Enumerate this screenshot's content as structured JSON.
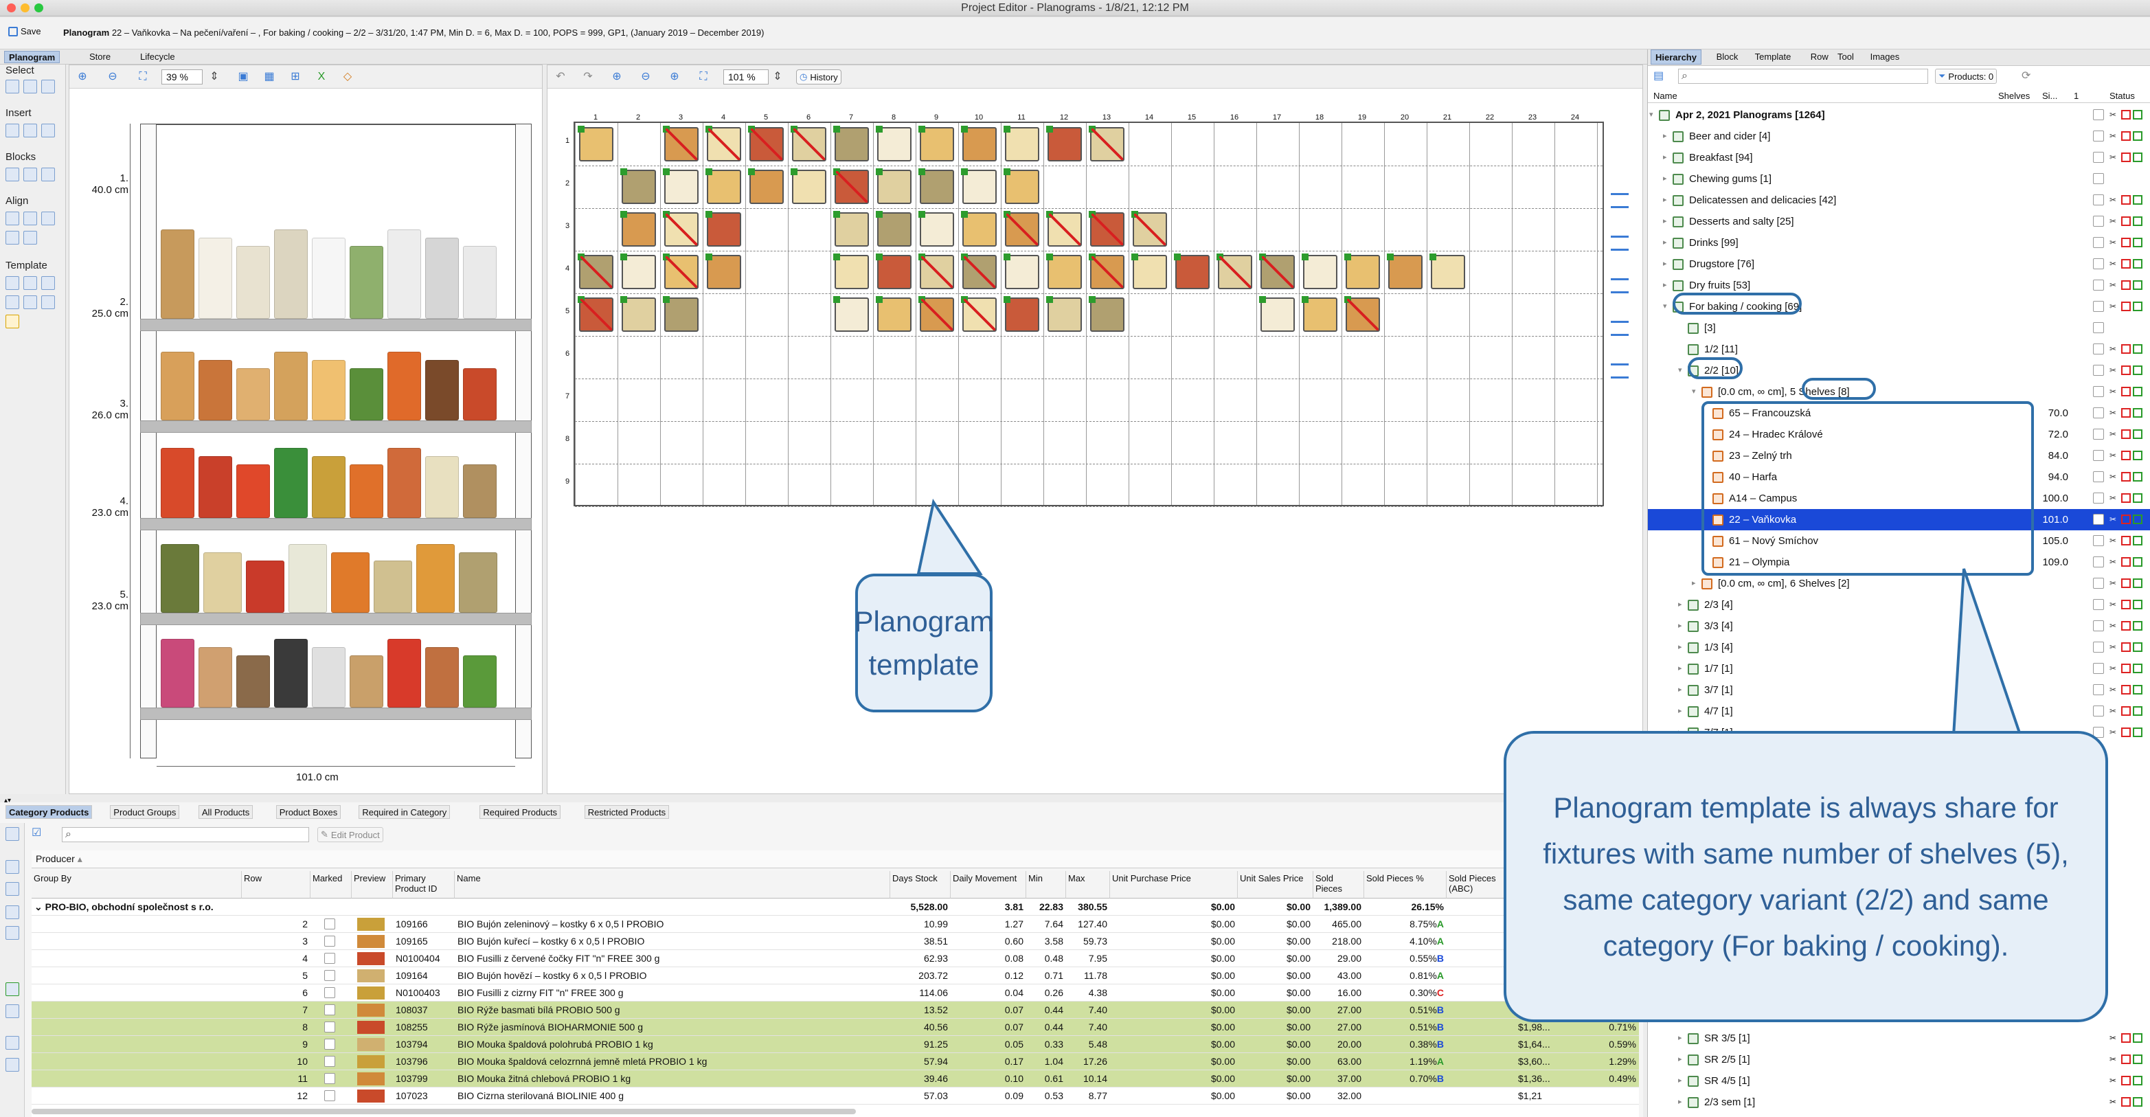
{
  "window": {
    "title": "Project Editor - Planograms - 1/8/21, 12:12 PM"
  },
  "infobar": {
    "save_label": "Save",
    "planogram_prefix": "Planogram",
    "planogram_desc": "22 – Vaňkovka – Na pečení/vaření – , For baking / cooking – 2/2 – 3/31/20, 1:47 PM, Min D. = 6, Max D. = 100, POPS = 999, GP1, (January 2019 – December 2019)"
  },
  "top_tabs": [
    "Planogram",
    "Store",
    "Lifecycle"
  ],
  "palette": {
    "select": "Select",
    "insert": "Insert",
    "blocks": "Blocks",
    "align": "Align",
    "template": "Template"
  },
  "panel1": {
    "zoom": "39 %",
    "width_label": "101.0 cm",
    "shelves": [
      {
        "num": "1.",
        "height": "40.0 cm"
      },
      {
        "num": "2.",
        "height": "25.0 cm"
      },
      {
        "num": "3.",
        "height": "26.0 cm"
      },
      {
        "num": "4.",
        "height": "23.0 cm"
      },
      {
        "num": "5.",
        "height": "23.0 cm"
      }
    ]
  },
  "panel2": {
    "zoom": "101 %",
    "history_label": "History",
    "columns": [
      "1",
      "2",
      "3",
      "4",
      "5",
      "6",
      "7",
      "8",
      "9",
      "10",
      "11",
      "12",
      "13",
      "14",
      "15",
      "16",
      "17",
      "18",
      "19",
      "20",
      "21",
      "22",
      "23",
      "24"
    ],
    "rows": [
      "1",
      "2",
      "3",
      "4",
      "5",
      "6",
      "7",
      "8",
      "9"
    ],
    "callout": "Planogram template"
  },
  "bottom": {
    "tabs": [
      "Category Products",
      "Product Groups",
      "All Products",
      "Product Boxes",
      "Required in Category",
      "Required Products",
      "Restricted Products"
    ],
    "edit_product_label": "Edit Product",
    "group_header": "Producer",
    "columns": [
      "Group By",
      "Row",
      "Marked",
      "Preview",
      "Primary Product ID",
      "Name",
      "Days Stock",
      "Daily Movement",
      "Min",
      "Max",
      "Unit Purchase Price",
      "Unit Sales Price",
      "Sold Pieces",
      "Sold Pieces %",
      "Sold Pieces (ABC)",
      "T"
    ],
    "group_row": {
      "name": "PRO-BIO, obchodní společnost s r.o.",
      "days": "5,528.00",
      "daily": "3.81",
      "min": "22.83",
      "max": "380.55",
      "upp": "$0.00",
      "usp": "$0.00",
      "sold": "1,389.00",
      "pct": "26.15%",
      "t": "$"
    },
    "rows": [
      {
        "row": "2",
        "id": "109166",
        "name": "BIO Bujón zeleninový – kostky 6 x 0,5 l PROBIO",
        "days": "10.99",
        "daily": "1.27",
        "min": "7.64",
        "max": "127.40",
        "upp": "$0.00",
        "usp": "$0.00",
        "sold": "465.00",
        "pct": "8.75%",
        "abc": "A",
        "hl": false,
        "t": "",
        "t2": ""
      },
      {
        "row": "3",
        "id": "109165",
        "name": "BIO Bujón kuřecí – kostky 6 x 0,5 l PROBIO",
        "days": "38.51",
        "daily": "0.60",
        "min": "3.58",
        "max": "59.73",
        "upp": "$0.00",
        "usp": "$0.00",
        "sold": "218.00",
        "pct": "4.10%",
        "abc": "A",
        "hl": false,
        "t": "",
        "t2": ""
      },
      {
        "row": "4",
        "id": "N0100404",
        "name": "BIO Fusilli z červené čočky FIT \"n\" FREE 300 g",
        "days": "62.93",
        "daily": "0.08",
        "min": "0.48",
        "max": "7.95",
        "upp": "$0.00",
        "usp": "$0.00",
        "sold": "29.00",
        "pct": "0.55%",
        "abc": "B",
        "hl": false,
        "t": "",
        "t2": ""
      },
      {
        "row": "5",
        "id": "109164",
        "name": "BIO Bujón hovězí – kostky 6 x 0,5 l PROBIO",
        "days": "203.72",
        "daily": "0.12",
        "min": "0.71",
        "max": "11.78",
        "upp": "$0.00",
        "usp": "$0.00",
        "sold": "43.00",
        "pct": "0.81%",
        "abc": "A",
        "hl": false,
        "t": "",
        "t2": ""
      },
      {
        "row": "6",
        "id": "N0100403",
        "name": "BIO Fusilli z cizrny FIT \"n\" FREE 300 g",
        "days": "114.06",
        "daily": "0.04",
        "min": "0.26",
        "max": "4.38",
        "upp": "$0.00",
        "usp": "$0.00",
        "sold": "16.00",
        "pct": "0.30%",
        "abc": "C",
        "hl": false,
        "t": "",
        "t2": ""
      },
      {
        "row": "7",
        "id": "108037",
        "name": "BIO Rýže basmati bílá PROBIO 500 g",
        "days": "13.52",
        "daily": "0.07",
        "min": "0.44",
        "max": "7.40",
        "upp": "$0.00",
        "usp": "$0.00",
        "sold": "27.00",
        "pct": "0.51%",
        "abc": "B",
        "hl": true,
        "t": "$1,8",
        "t2": ""
      },
      {
        "row": "8",
        "id": "108255",
        "name": "BIO Rýže jasmínová BIOHARMONIE 500 g",
        "days": "40.56",
        "daily": "0.07",
        "min": "0.44",
        "max": "7.40",
        "upp": "$0.00",
        "usp": "$0.00",
        "sold": "27.00",
        "pct": "0.51%",
        "abc": "B",
        "hl": true,
        "t": "$1,98...",
        "t2": "0.71%"
      },
      {
        "row": "9",
        "id": "103794",
        "name": "BIO Mouka špaldová polohrubá PROBIO 1 kg",
        "days": "91.25",
        "daily": "0.05",
        "min": "0.33",
        "max": "5.48",
        "upp": "$0.00",
        "usp": "$0.00",
        "sold": "20.00",
        "pct": "0.38%",
        "abc": "B",
        "hl": true,
        "t": "$1,64...",
        "t2": "0.59%"
      },
      {
        "row": "10",
        "id": "103796",
        "name": "BIO Mouka špaldová celozrnná jemně mletá PROBIO 1 kg",
        "days": "57.94",
        "daily": "0.17",
        "min": "1.04",
        "max": "17.26",
        "upp": "$0.00",
        "usp": "$0.00",
        "sold": "63.00",
        "pct": "1.19%",
        "abc": "A",
        "hl": true,
        "t": "$3,60...",
        "t2": "1.29%"
      },
      {
        "row": "11",
        "id": "103799",
        "name": "BIO Mouka žitná chlebová PROBIO 1 kg",
        "days": "39.46",
        "daily": "0.10",
        "min": "0.61",
        "max": "10.14",
        "upp": "$0.00",
        "usp": "$0.00",
        "sold": "37.00",
        "pct": "0.70%",
        "abc": "B",
        "hl": true,
        "t": "$1,36...",
        "t2": "0.49%"
      },
      {
        "row": "12",
        "id": "107023",
        "name": "BIO Cizrna sterilovaná BIOLINIE 400 g",
        "days": "57.03",
        "daily": "0.09",
        "min": "0.53",
        "max": "8.77",
        "upp": "$0.00",
        "usp": "$0.00",
        "sold": "32.00",
        "pct": "",
        "abc": "",
        "hl": false,
        "t": "$1,21",
        "t2": ""
      }
    ]
  },
  "right": {
    "tabs": [
      "Hierarchy",
      "Block",
      "Template",
      "Row",
      "Tool",
      "Images"
    ],
    "products_count": "Products: 0",
    "cols": {
      "name": "Name",
      "shelves": "Shelves",
      "si": "Si...",
      "one": "1",
      "status": "Status"
    },
    "tree": [
      {
        "label": "Apr 2, 2021 Planograms [1264]",
        "indent": 0,
        "bold": true,
        "icon": "green",
        "val": ""
      },
      {
        "label": "Beer and cider [4]",
        "indent": 1,
        "icon": "green",
        "val": ""
      },
      {
        "label": "Breakfast [94]",
        "indent": 1,
        "icon": "green",
        "val": ""
      },
      {
        "label": "Chewing gums [1]",
        "indent": 1,
        "icon": "green",
        "val": ""
      },
      {
        "label": "Delicatessen and delicacies [42]",
        "indent": 1,
        "icon": "green",
        "val": ""
      },
      {
        "label": "Desserts and salty [25]",
        "indent": 1,
        "icon": "green",
        "val": ""
      },
      {
        "label": "Drinks [99]",
        "indent": 1,
        "icon": "green",
        "val": ""
      },
      {
        "label": "Drugstore [76]",
        "indent": 1,
        "icon": "green",
        "val": ""
      },
      {
        "label": "Dry fruits [53]",
        "indent": 1,
        "icon": "green",
        "val": ""
      },
      {
        "label": "For baking / cooking [69]",
        "indent": 1,
        "icon": "green",
        "val": ""
      },
      {
        "label": "[3]",
        "indent": 2,
        "icon": "green",
        "val": ""
      },
      {
        "label": "1/2 [11]",
        "indent": 2,
        "icon": "green",
        "val": ""
      },
      {
        "label": "2/2 [10]",
        "indent": 2,
        "icon": "green",
        "val": ""
      },
      {
        "label": "[0.0 cm, ∞ cm], 5 Shelves [8]",
        "indent": 3,
        "icon": "orange",
        "val": ""
      },
      {
        "label": "65 – Francouzská",
        "indent": 4,
        "icon": "orange",
        "val": "70.0"
      },
      {
        "label": "24 – Hradec Králové",
        "indent": 4,
        "icon": "orange",
        "val": "72.0"
      },
      {
        "label": "23 – Zelný trh",
        "indent": 4,
        "icon": "orange",
        "val": "84.0"
      },
      {
        "label": "40 – Harfa",
        "indent": 4,
        "icon": "orange",
        "val": "94.0"
      },
      {
        "label": "A14 – Campus",
        "indent": 4,
        "icon": "orange",
        "val": "100.0"
      },
      {
        "label": "22 – Vaňkovka",
        "indent": 4,
        "icon": "orange",
        "val": "101.0",
        "sel": true
      },
      {
        "label": "61 – Nový Smíchov",
        "indent": 4,
        "icon": "orange",
        "val": "105.0"
      },
      {
        "label": "21 – Olympia",
        "indent": 4,
        "icon": "orange",
        "val": "109.0"
      },
      {
        "label": "[0.0 cm, ∞ cm], 6 Shelves [2]",
        "indent": 3,
        "icon": "orange",
        "val": ""
      },
      {
        "label": "2/3 [4]",
        "indent": 2,
        "icon": "green",
        "val": ""
      },
      {
        "label": "3/3 [4]",
        "indent": 2,
        "icon": "green",
        "val": ""
      },
      {
        "label": "1/3 [4]",
        "indent": 2,
        "icon": "green",
        "val": ""
      },
      {
        "label": "1/7 [1]",
        "indent": 2,
        "icon": "green",
        "val": ""
      },
      {
        "label": "3/7 [1]",
        "indent": 2,
        "icon": "green",
        "val": ""
      },
      {
        "label": "4/7 [1]",
        "indent": 2,
        "icon": "green",
        "val": ""
      },
      {
        "label": "7/7 [1]",
        "indent": 2,
        "icon": "green",
        "val": ""
      }
    ],
    "tree_tail": [
      {
        "label": "SR 3/5 [1]",
        "icon": "green"
      },
      {
        "label": "SR 2/5 [1]",
        "icon": "green"
      },
      {
        "label": "SR 4/5 [1]",
        "icon": "green"
      },
      {
        "label": "2/3 sem [1]",
        "icon": "green"
      }
    ],
    "callout": "Planogram template is always share for fixtures with same number of shelves (5), same category variant (2/2) and same category (For baking / cooking)."
  },
  "colors": {
    "accent": "#2f6fa8",
    "selection": "#1a49d8",
    "highlight_row": "#cfe0a0",
    "status_red": "#d22222",
    "status_green": "#2a9a2a"
  }
}
